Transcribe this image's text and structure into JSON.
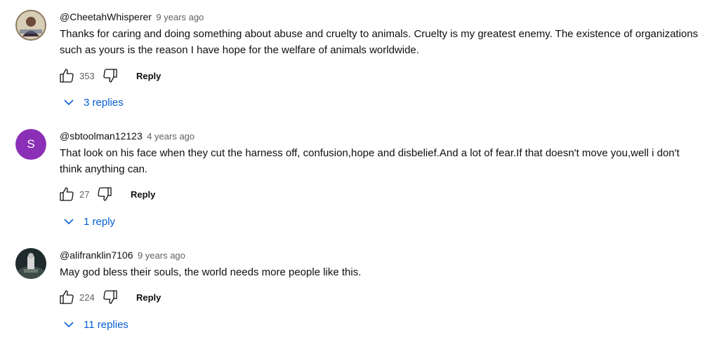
{
  "colors": {
    "link": "#065fd4",
    "meta": "#606060",
    "avatar_s": "#8b2fb7"
  },
  "actions": {
    "reply_label": "Reply"
  },
  "comments": [
    {
      "author": "@CheetahWhisperer",
      "time": "9 years ago",
      "text": "Thanks for caring and doing something about abuse and cruelty to animals.  Cruelty is my greatest enemy.  The existence of organizations such as yours is the reason I have hope for the welfare of animals worldwide.",
      "likes": "353",
      "replies": "3 replies",
      "avatar": "photo"
    },
    {
      "author": "@sbtoolman12123",
      "time": "4 years ago",
      "text": "That look on his face when they cut the harness off, confusion,hope and disbelief.And a lot of fear.If that doesn't move you,well i don't think anything can.",
      "likes": "27",
      "replies": "1 reply",
      "avatar": "S"
    },
    {
      "author": "@alifranklin7106",
      "time": "9 years ago",
      "text": "May god bless their souls, the world needs more people like this.",
      "likes": "224",
      "replies": "11 replies",
      "avatar": "photo"
    }
  ]
}
